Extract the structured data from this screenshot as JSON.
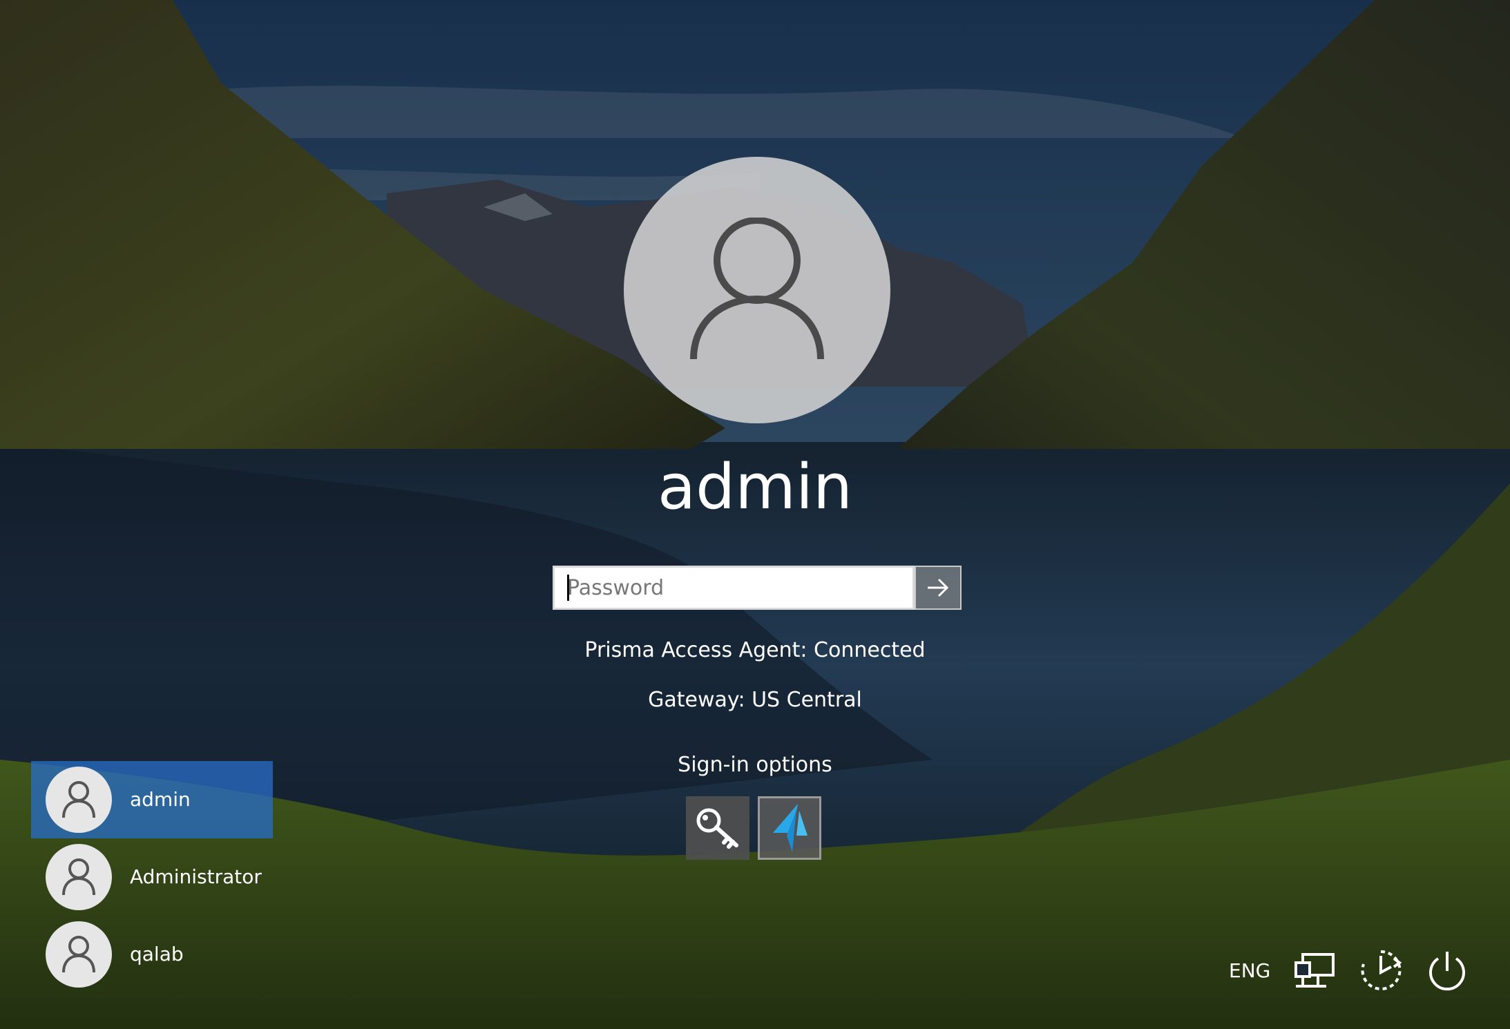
{
  "login": {
    "username": "admin",
    "password_placeholder": "Password",
    "status_line_1": "Prisma Access Agent: Connected",
    "status_line_2": "Gateway: US Central",
    "signin_options_label": "Sign-in options"
  },
  "signin_options": [
    {
      "icon": "key-icon"
    },
    {
      "icon": "prisma-access-icon"
    }
  ],
  "users": [
    {
      "name": "admin",
      "selected": true
    },
    {
      "name": "Administrator",
      "selected": false
    },
    {
      "name": "qalab",
      "selected": false
    }
  ],
  "tray": {
    "language": "ENG",
    "icons": [
      "network-icon",
      "ease-of-access-icon",
      "power-icon"
    ]
  },
  "colors": {
    "selected_user": "#286ec8",
    "prisma_blue": "#2aa7e8"
  }
}
